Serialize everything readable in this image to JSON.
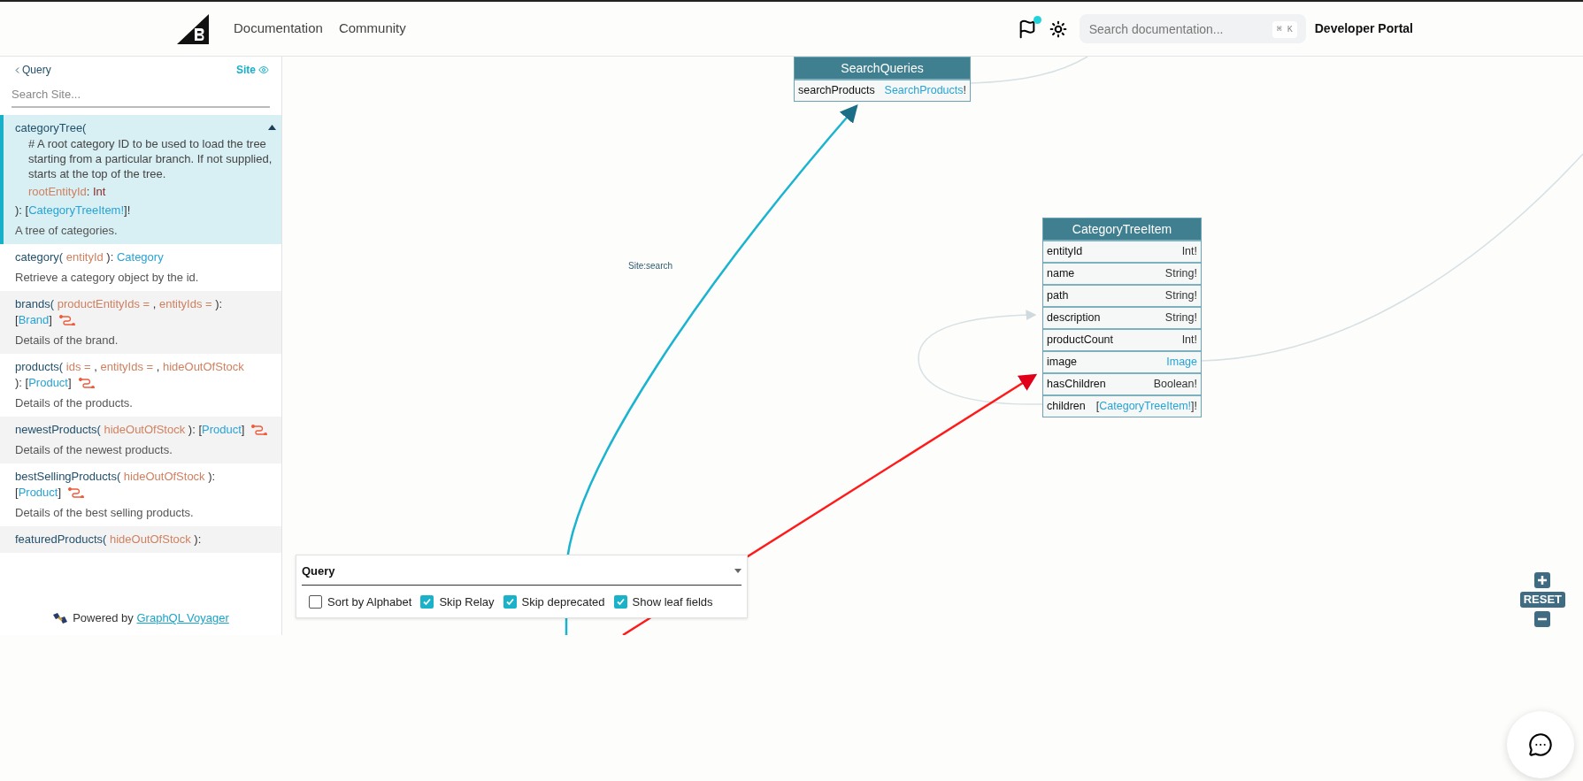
{
  "header": {
    "nav": [
      "Documentation",
      "Community"
    ],
    "notification": true,
    "search": {
      "placeholder": "Search documentation...",
      "shortcut": "⌘ K"
    },
    "title": "Developer Portal"
  },
  "sidebar": {
    "back_label": "Query",
    "root_label": "Site",
    "search": {
      "placeholder": "Search Site..."
    },
    "items": [
      {
        "kind": "expanded",
        "selected": true,
        "open": [
          {
            "kind": "name",
            "text": "categoryTree("
          }
        ],
        "comment": "# A root category ID to be used to load the tree starting from a particular branch. If not supplied, starts at the top of the tree.",
        "args": [
          [
            {
              "kind": "arg",
              "text": "rootEntityId"
            },
            {
              "kind": "punct",
              "text": ": "
            },
            {
              "kind": "scalar",
              "text": "Int"
            }
          ]
        ],
        "close": [
          {
            "kind": "punct",
            "text": "): ["
          },
          {
            "kind": "type",
            "text": "CategoryTreeItem!"
          },
          {
            "kind": "punct",
            "text": "]!"
          }
        ],
        "description": "A tree of categories."
      },
      {
        "kind": "collapsed",
        "selected": false,
        "lines": [
          [
            {
              "kind": "name",
              "text": "category("
            },
            {
              "kind": "arg",
              "text": " entityId "
            },
            {
              "kind": "punct",
              "text": "): "
            },
            {
              "kind": "type",
              "text": "Category"
            }
          ]
        ],
        "description": "Retrieve a category object by the id."
      },
      {
        "kind": "collapsed",
        "selected": false,
        "relay": true,
        "lines": [
          [
            {
              "kind": "name",
              "text": "brands("
            },
            {
              "kind": "arg",
              "text": " productEntityIds = "
            },
            {
              "kind": "punct",
              "text": ", "
            },
            {
              "kind": "arg",
              "text": "entityIds = "
            },
            {
              "kind": "punct",
              "text": "):"
            }
          ],
          [
            {
              "kind": "punct",
              "text": "["
            },
            {
              "kind": "type",
              "text": "Brand"
            },
            {
              "kind": "punct",
              "text": "]"
            }
          ]
        ],
        "description": "Details of the brand."
      },
      {
        "kind": "collapsed",
        "selected": false,
        "relay": true,
        "lines": [
          [
            {
              "kind": "name",
              "text": "products("
            },
            {
              "kind": "arg",
              "text": " ids = "
            },
            {
              "kind": "punct",
              "text": ", "
            },
            {
              "kind": "arg",
              "text": "entityIds = "
            },
            {
              "kind": "punct",
              "text": ", "
            },
            {
              "kind": "arg",
              "text": "hideOutOfStock"
            }
          ],
          [
            {
              "kind": "punct",
              "text": "): ["
            },
            {
              "kind": "type",
              "text": "Product"
            },
            {
              "kind": "punct",
              "text": "]"
            }
          ]
        ],
        "description": "Details of the products."
      },
      {
        "kind": "collapsed",
        "selected": false,
        "relay": true,
        "lines": [
          [
            {
              "kind": "name",
              "text": "newestProducts("
            },
            {
              "kind": "arg",
              "text": " hideOutOfStock "
            },
            {
              "kind": "punct",
              "text": "): ["
            },
            {
              "kind": "type",
              "text": "Product"
            },
            {
              "kind": "punct",
              "text": "]"
            }
          ]
        ],
        "description": "Details of the newest products."
      },
      {
        "kind": "collapsed",
        "selected": false,
        "relay": true,
        "lines": [
          [
            {
              "kind": "name",
              "text": "bestSellingProducts("
            },
            {
              "kind": "arg",
              "text": " hideOutOfStock "
            },
            {
              "kind": "punct",
              "text": "):"
            }
          ],
          [
            {
              "kind": "punct",
              "text": "["
            },
            {
              "kind": "type",
              "text": "Product"
            },
            {
              "kind": "punct",
              "text": "]"
            }
          ]
        ],
        "description": "Details of the best selling products."
      },
      {
        "kind": "collapsed",
        "selected": false,
        "lines": [
          [
            {
              "kind": "name",
              "text": "featuredProducts("
            },
            {
              "kind": "arg",
              "text": " hideOutOfStock "
            },
            {
              "kind": "punct",
              "text": "):"
            }
          ]
        ]
      }
    ],
    "footer": {
      "text": "Powered by",
      "link": "GraphQL Voyager"
    }
  },
  "graph": {
    "nodes": [
      {
        "title": "SearchQueries",
        "fields": [
          {
            "name": "searchProducts",
            "type": [
              {
                "kind": "type",
                "text": "SearchProducts"
              },
              {
                "kind": "punct",
                "text": "!"
              }
            ]
          }
        ]
      },
      {
        "title": "CategoryTreeItem",
        "fields": [
          {
            "name": "entityId",
            "type": [
              {
                "kind": "punct",
                "text": "Int!"
              }
            ]
          },
          {
            "name": "name",
            "type": [
              {
                "kind": "punct",
                "text": "String!"
              }
            ]
          },
          {
            "name": "path",
            "type": [
              {
                "kind": "punct",
                "text": "String!"
              }
            ]
          },
          {
            "name": "description",
            "type": [
              {
                "kind": "punct",
                "text": "String!"
              }
            ]
          },
          {
            "name": "productCount",
            "type": [
              {
                "kind": "punct",
                "text": "Int!"
              }
            ]
          },
          {
            "name": "image",
            "type": [
              {
                "kind": "type",
                "text": "Image"
              }
            ]
          },
          {
            "name": "hasChildren",
            "type": [
              {
                "kind": "punct",
                "text": "Boolean!"
              }
            ]
          },
          {
            "name": "children",
            "type": [
              {
                "kind": "punct",
                "text": "["
              },
              {
                "kind": "type",
                "text": "CategoryTreeItem!"
              },
              {
                "kind": "punct",
                "text": "]!"
              }
            ]
          }
        ]
      }
    ],
    "edge_label": "Site:search"
  },
  "query_panel": {
    "title": "Query",
    "options": [
      {
        "label": "Sort by Alphabet",
        "checked": false
      },
      {
        "label": "Skip Relay",
        "checked": true
      },
      {
        "label": "Skip deprecated",
        "checked": true
      },
      {
        "label": "Show leaf fields",
        "checked": true
      }
    ]
  },
  "zoom_controls": {
    "reset_label": "RESET"
  }
}
